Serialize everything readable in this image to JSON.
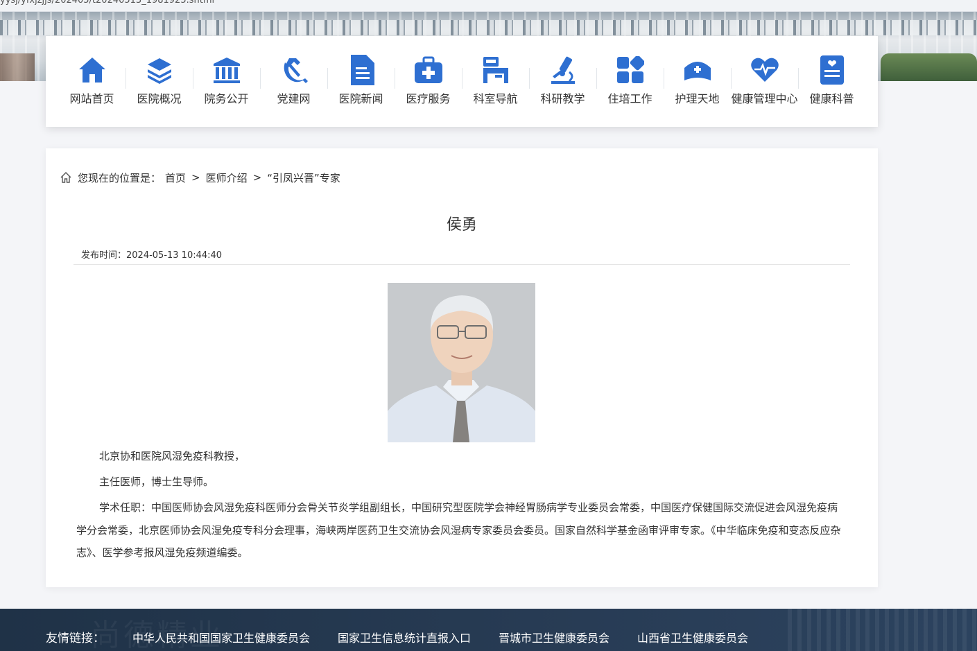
{
  "browser": {
    "url": "yysj/yfxjzjjs/202405/t20240513_1981925.shtml"
  },
  "nav": {
    "items": [
      {
        "label": "网站首页",
        "icon": "home-icon"
      },
      {
        "label": "医院概况",
        "icon": "layers-icon"
      },
      {
        "label": "院务公开",
        "icon": "building-icon"
      },
      {
        "label": "党建网",
        "icon": "party-emblem-icon"
      },
      {
        "label": "医院新闻",
        "icon": "document-icon"
      },
      {
        "label": "医疗服务",
        "icon": "medical-kit-icon"
      },
      {
        "label": "科室导航",
        "icon": "hospital-bed-icon"
      },
      {
        "label": "科研教学",
        "icon": "microscope-icon"
      },
      {
        "label": "住培工作",
        "icon": "grid-icon"
      },
      {
        "label": "护理天地",
        "icon": "nurse-cap-icon"
      },
      {
        "label": "健康管理中心",
        "icon": "heart-pulse-icon"
      },
      {
        "label": "健康科普",
        "icon": "clipboard-icon"
      }
    ],
    "accent": "#2e6fd1"
  },
  "breadcrumb": {
    "prefix": "您现在的位置是：",
    "items": [
      "首页",
      "医师介绍",
      "“引凤兴晋”专家"
    ],
    "separator": ">"
  },
  "article": {
    "title": "侯勇",
    "publish_time": "发布时间：2024-05-13 10:44:40",
    "paragraphs": [
      "北京协和医院风湿免疫科教授，",
      "主任医师，博士生导师。",
      "学术任职：中国医师协会风湿免疫科医师分会骨关节炎学组副组长，中国研究型医院学会神经胃肠病学专业委员会常委，中国医疗保健国际交流促进会风湿免疫病学分会常委，北京医师协会风湿免疫专科分会理事，海峡两岸医药卫生交流协会风湿病专家委员会委员。国家自然科学基金函审评审专家。《中华临床免疫和变态反应杂志》、医学参考报风湿免疫频道编委。"
    ]
  },
  "footer": {
    "links_heading": "友情链接：",
    "links": [
      "中华人民共和国国家卫生健康委员会",
      "国家卫生信息统计直报入口",
      "晋城市卫生健康委员会",
      "山西省卫生健康委员会"
    ],
    "background": "#233850"
  }
}
